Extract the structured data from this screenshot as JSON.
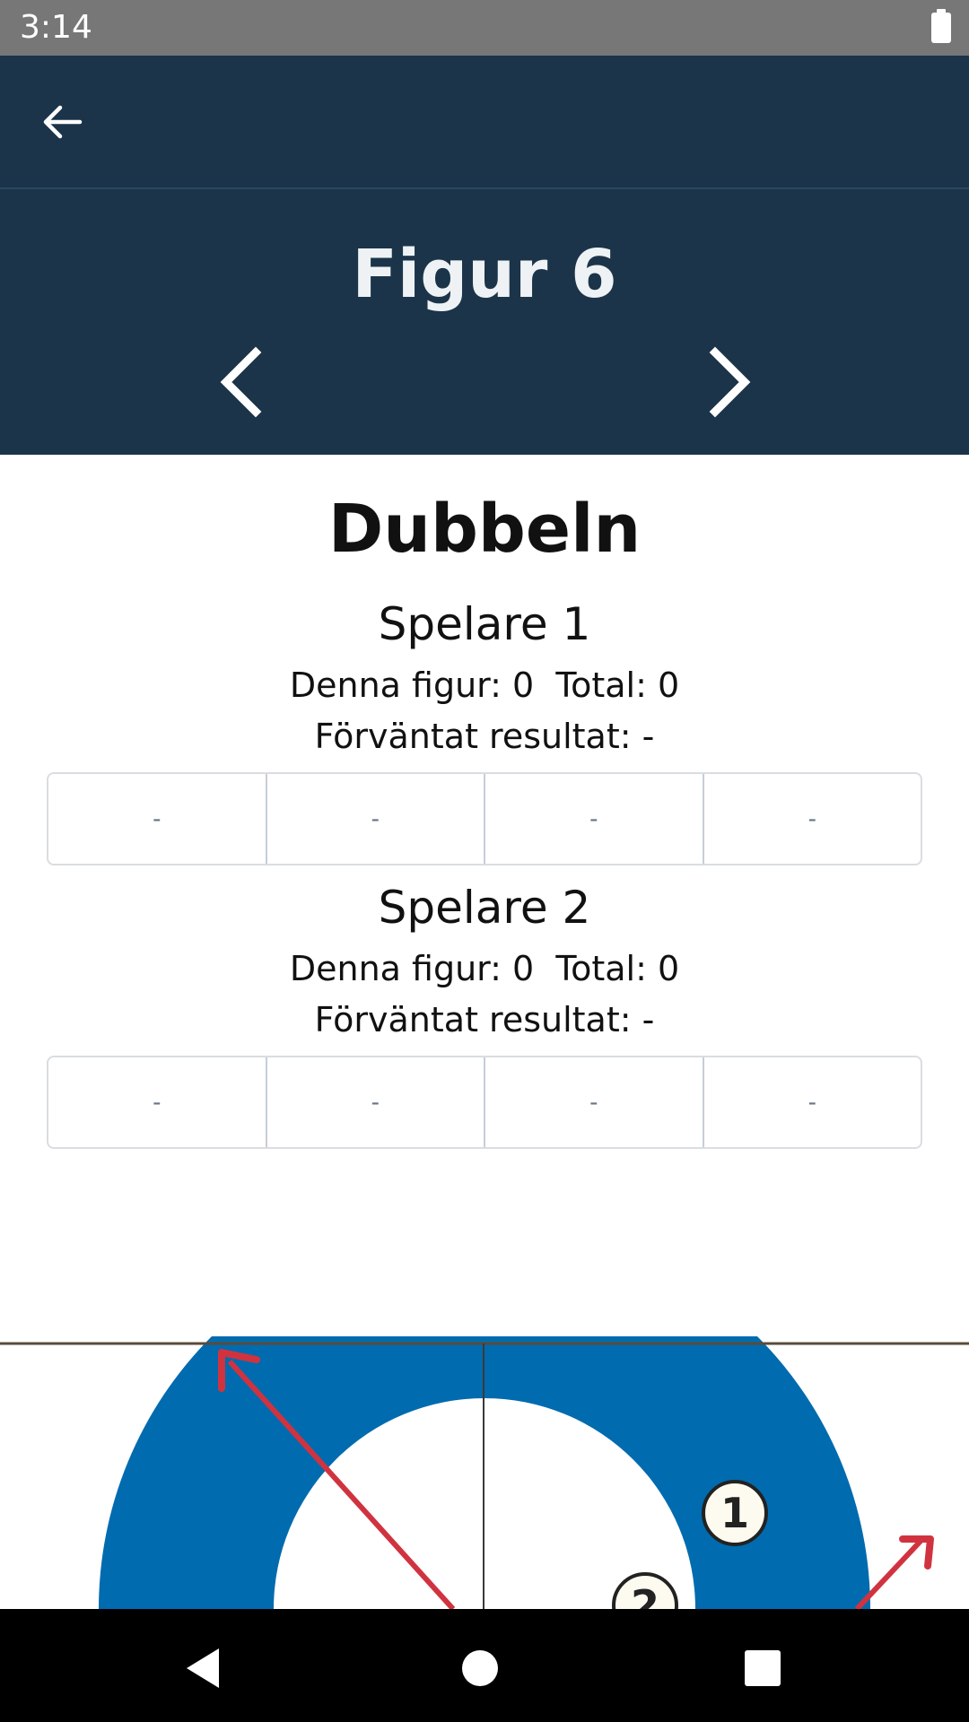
{
  "status_bar": {
    "time": "3:14"
  },
  "header": {
    "figure_title": "Figur 6"
  },
  "game": {
    "title": "Dubbeln",
    "players": [
      {
        "name": "Spelare 1",
        "score_line": "Denna figur: 0  Total: 0",
        "expected": "Förväntat resultat: -",
        "cells": [
          "-",
          "-",
          "-",
          "-"
        ]
      },
      {
        "name": "Spelare 2",
        "score_line": "Denna figur: 0  Total: 0",
        "expected": "Förväntat resultat: -",
        "cells": [
          "-",
          "-",
          "-",
          "-"
        ]
      }
    ]
  },
  "diagram": {
    "stone_labels": [
      "1",
      "2"
    ],
    "colors": {
      "house_ring": "#016baf",
      "arrow": "#d0333f",
      "line": "#5b4a3a"
    }
  },
  "colors": {
    "header_bg": "#1b3449",
    "status_bg": "#777777"
  },
  "icons": {
    "back": "arrow-left-icon",
    "prev": "chevron-left-icon",
    "next": "chevron-right-icon",
    "nav_back": "triangle-back-icon",
    "nav_home": "circle-home-icon",
    "nav_recents": "square-recents-icon"
  }
}
